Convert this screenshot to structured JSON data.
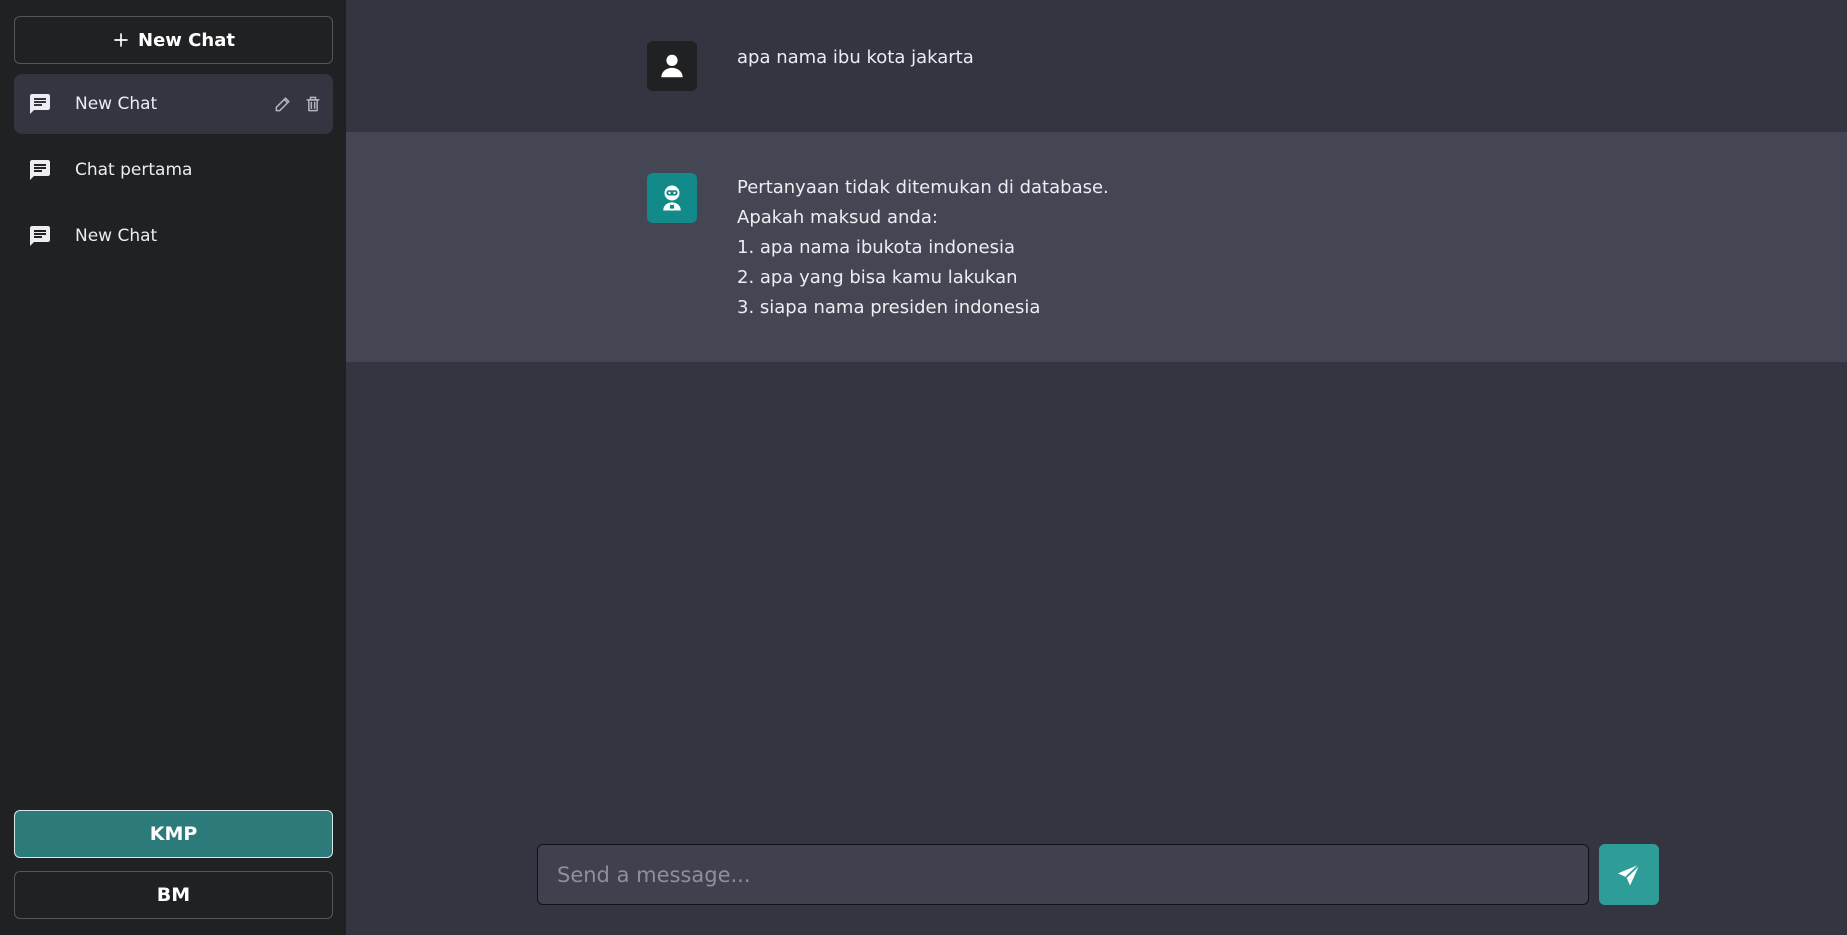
{
  "sidebar": {
    "new_chat_label": "New Chat",
    "history": [
      {
        "label": "New Chat",
        "active": true
      },
      {
        "label": "Chat pertama",
        "active": false
      },
      {
        "label": "New Chat",
        "active": false
      }
    ],
    "mode_buttons": [
      {
        "label": "KMP",
        "selected": true
      },
      {
        "label": "BM",
        "selected": false
      }
    ]
  },
  "conversation": {
    "user_message": "apa nama ibu kota jakarta",
    "bot_message_lines": [
      "Pertanyaan tidak ditemukan di database.",
      "Apakah maksud anda:",
      "1. apa nama ibukota indonesia",
      "2. apa yang bisa kamu lakukan",
      "3. siapa nama presiden indonesia"
    ]
  },
  "composer": {
    "placeholder": "Send a message...",
    "value": ""
  },
  "colors": {
    "sidebar_bg": "#202123",
    "main_bg": "#343541",
    "bot_row_bg": "#444654",
    "accent": "#2e9d98",
    "bot_avatar": "#138a8a"
  },
  "icons": {
    "new_chat": "plus-icon",
    "history_item": "chat-bubble-icon",
    "edit": "pencil-icon",
    "delete": "trash-icon",
    "user_avatar": "user-icon",
    "bot_avatar": "robot-icon",
    "send": "send-icon"
  }
}
